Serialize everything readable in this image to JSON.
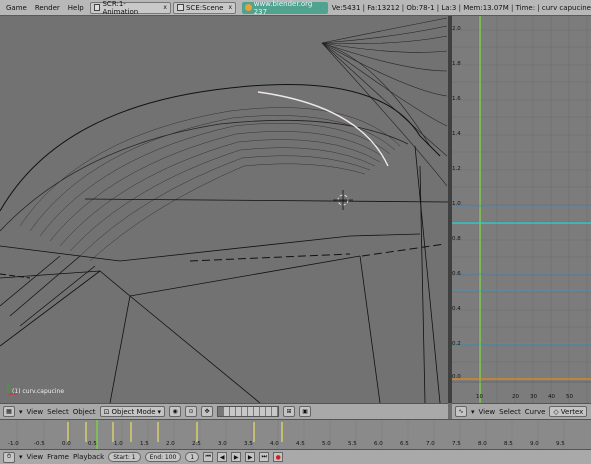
{
  "topbar": {
    "menus": [
      "Game",
      "Render",
      "Help"
    ],
    "screen_selector": "SCR:1-Animation",
    "scene_selector": "SCE:Scene",
    "url": "www.blender.org 237",
    "stats": "Ve:5431 | Fa:13212 | Ob:78-1 | La:3 | Mem:13.07M | Time: | curv capucine",
    "close_glyph": "x"
  },
  "viewport": {
    "object_label": "(1) curv.capucine"
  },
  "ipo": {
    "y_ticks": [
      "2.0",
      "1.8",
      "1.6",
      "1.4",
      "1.2",
      "1.0",
      "0.8",
      "0.6",
      "0.4",
      "0.2",
      "0.0"
    ],
    "x_ticks": [
      "10",
      "20",
      "30",
      "40",
      "50"
    ]
  },
  "viewport_header": {
    "menus": [
      "View",
      "Select",
      "Object"
    ],
    "mode": "Object Mode"
  },
  "ipo_header": {
    "menus": [
      "View",
      "Select",
      "Curve"
    ],
    "vertex_label": "Vertex"
  },
  "timeline": {
    "ticks": [
      "-1.0",
      "-0.5",
      "0.0",
      "0.5",
      "1.0",
      "1.5",
      "2.0",
      "2.5",
      "3.0",
      "3.5",
      "4.0",
      "4.5",
      "5.0",
      "5.5",
      "6.0",
      "6.5",
      "7.0",
      "7.5",
      "8.0",
      "8.5",
      "9.0",
      "9.5"
    ]
  },
  "timeline_header": {
    "menus": [
      "View",
      "Frame",
      "Playback"
    ],
    "start": "Start: 1",
    "end": "End: 100",
    "current_frame": "1"
  },
  "colors": {
    "ipo_curve_green": "#7fd34a",
    "ipo_cyan": "#29d4d4",
    "ipo_orange": "#e08a1e",
    "url_badge": "#4fa38f"
  }
}
